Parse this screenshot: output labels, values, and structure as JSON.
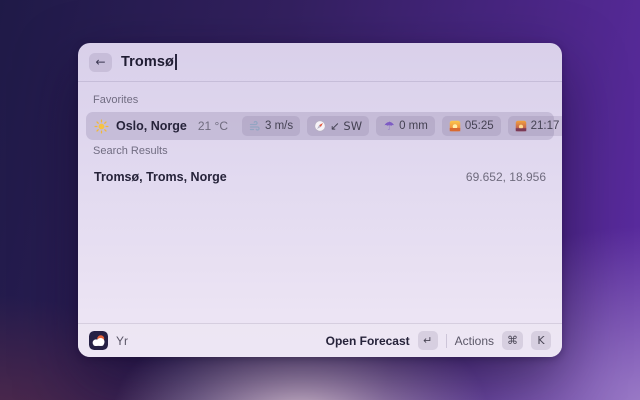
{
  "search": {
    "back_label": "←",
    "query": "Tromsø"
  },
  "favorites": {
    "title": "Favorites",
    "item": {
      "icon": "sun-icon",
      "title": "Oslo, Norge",
      "temperature": "21 °C",
      "tags": [
        {
          "icon": "wind-icon",
          "label": "3 m/s"
        },
        {
          "icon": "compass-icon",
          "label": "↙ SW"
        },
        {
          "icon": "umbrella-icon",
          "label": "0 mm"
        },
        {
          "icon": "sunrise-icon",
          "label": "05:25"
        },
        {
          "icon": "sunset-icon",
          "label": "21:17"
        }
      ]
    }
  },
  "search_results": {
    "title": "Search Results",
    "item": {
      "title": "Tromsø, Troms, Norge",
      "coordinates": "69.652, 18.956"
    }
  },
  "footer": {
    "app_icon": "yr-app-icon",
    "app_name": "Yr",
    "primary_action": "Open Forecast",
    "primary_key": "↵",
    "secondary_action": "Actions",
    "secondary_key_1": "⌘",
    "secondary_key_2": "K"
  },
  "colors": {
    "desktop_top_left": "#1f1a47",
    "desktop_top_right": "#5c2ba2",
    "desktop_bottom_left": "#45243f",
    "desktop_bottom_right": "#9377bf",
    "window_background": "#e2daf0",
    "selected_row": "#cdc5dd",
    "primary_text": "#26233a",
    "secondary_text": "#6f6b7e",
    "sun_yellow": "#f6c344",
    "compass_needle": "#e2543a",
    "umbrella_purple": "#7e5cc4",
    "yr_icon_navy": "#262145"
  }
}
